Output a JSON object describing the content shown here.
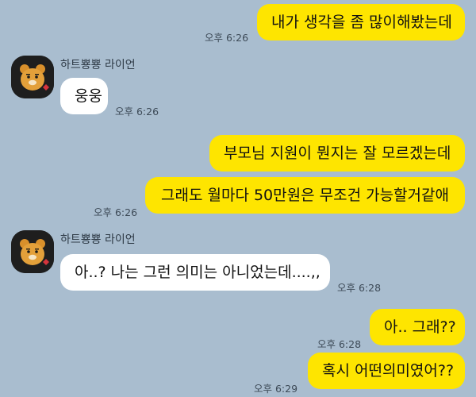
{
  "messages": [
    {
      "text": "내가 생각을 좀 많이해봤는데",
      "time": "오후 6:26"
    },
    {
      "sender": "하트뿅뿅 라이언",
      "text": "웅웅",
      "time": "오후 6:26"
    },
    {
      "text": "부모님 지원이 뭔지는 잘 모르겠는데"
    },
    {
      "text": "그래도 월마다 50만원은 무조건 가능할거같애",
      "time": "오후 6:26"
    },
    {
      "sender": "하트뿅뿅 라이언",
      "text": "아..? 나는 그런 의미는 아니었는데....,,",
      "time": "오후 6:28"
    },
    {
      "text": "아.. 그래??",
      "time": "오후 6:28"
    },
    {
      "text": "혹시 어떤의미였어??",
      "time": "오후 6:29"
    }
  ],
  "colors": {
    "background": "#a9bdcf",
    "my_bubble": "#fee500",
    "their_bubble": "#ffffff"
  },
  "icons": {
    "avatar": "ryan-bear-avatar-icon"
  }
}
